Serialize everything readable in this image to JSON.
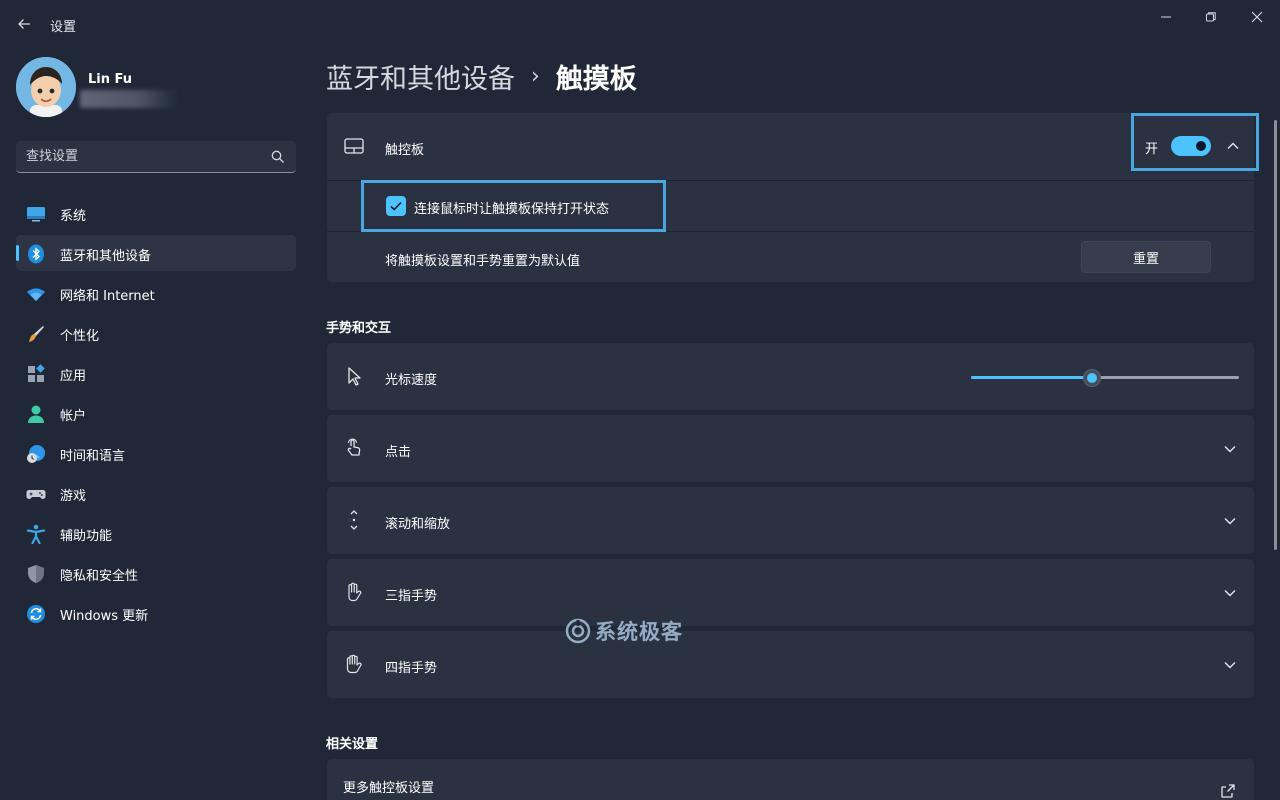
{
  "window": {
    "title": "设置"
  },
  "profile": {
    "name": "Lin Fu"
  },
  "search": {
    "placeholder": "查找设置"
  },
  "sidebar": {
    "items": [
      {
        "label": "系统",
        "icon": "system-icon"
      },
      {
        "label": "蓝牙和其他设备",
        "icon": "bluetooth-icon",
        "active": true
      },
      {
        "label": "网络和 Internet",
        "icon": "wifi-icon"
      },
      {
        "label": "个性化",
        "icon": "brush-icon"
      },
      {
        "label": "应用",
        "icon": "apps-icon"
      },
      {
        "label": "帐户",
        "icon": "account-icon"
      },
      {
        "label": "时间和语言",
        "icon": "time-language-icon"
      },
      {
        "label": "游戏",
        "icon": "gamepad-icon"
      },
      {
        "label": "辅助功能",
        "icon": "accessibility-icon"
      },
      {
        "label": "隐私和安全性",
        "icon": "shield-icon"
      },
      {
        "label": "Windows 更新",
        "icon": "update-icon"
      }
    ]
  },
  "breadcrumb": {
    "parent": "蓝牙和其他设备",
    "separator": "›",
    "current": "触摸板"
  },
  "touchpad": {
    "label": "触控板",
    "toggle_state": "开",
    "toggle_on": true,
    "keep_on_label": "连接鼠标时让触摸板保持打开状态",
    "keep_on_checked": true,
    "reset_desc": "将触摸板设置和手势重置为默认值",
    "reset_button": "重置"
  },
  "gestures": {
    "section_title": "手势和交互",
    "cursor_speed_label": "光标速度",
    "cursor_speed_fraction": 0.45,
    "rows": [
      {
        "label": "点击",
        "icon": "tap-icon"
      },
      {
        "label": "滚动和缩放",
        "icon": "scroll-icon"
      },
      {
        "label": "三指手势",
        "icon": "three-finger-icon"
      },
      {
        "label": "四指手势",
        "icon": "four-finger-icon"
      }
    ]
  },
  "related": {
    "section_title": "相关设置",
    "more_label": "更多触控板设置"
  },
  "watermark": {
    "text": "系统极客"
  },
  "colors": {
    "accent": "#4cc2ff",
    "background": "#202838",
    "card": "#2a3141",
    "highlight_border": "#4aa7dd"
  }
}
